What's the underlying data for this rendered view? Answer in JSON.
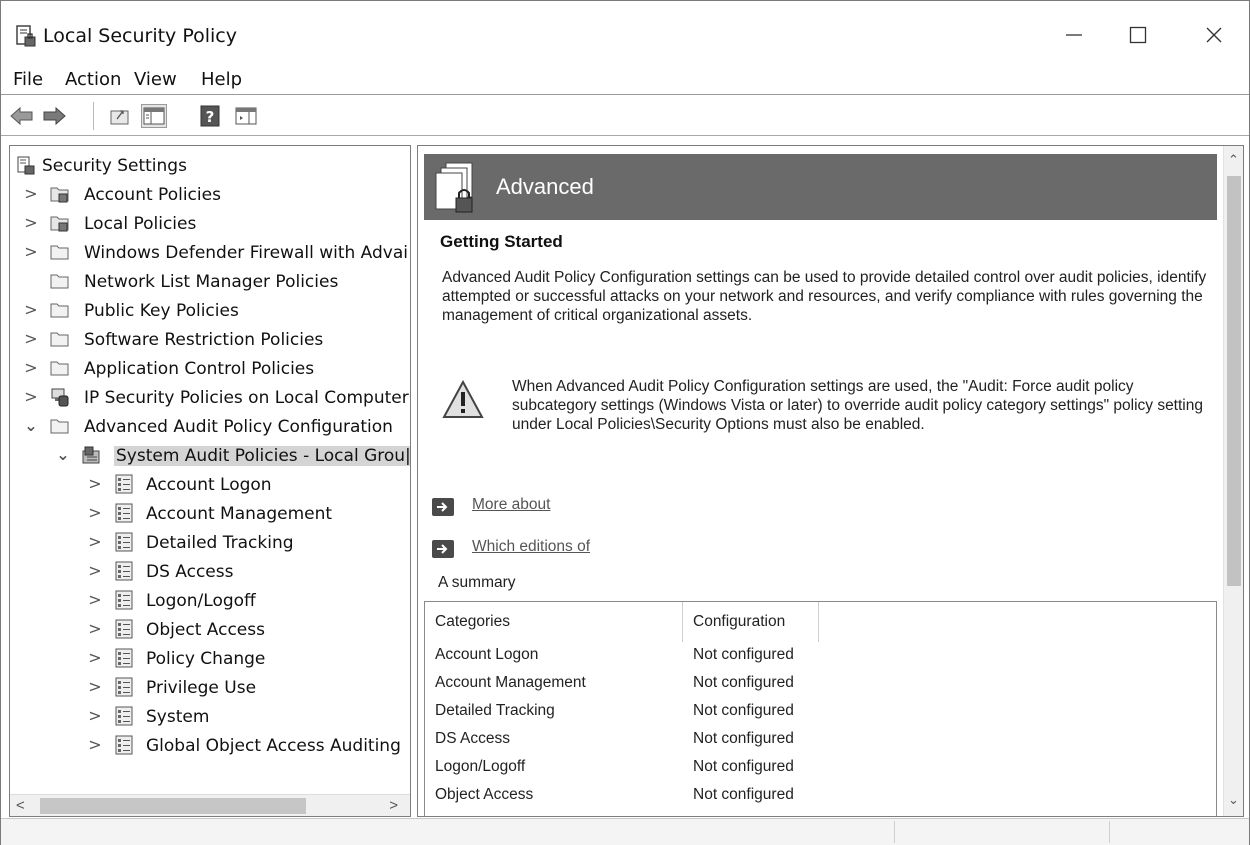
{
  "window": {
    "title": "Local Security Policy"
  },
  "menu": {
    "file": "File",
    "action": "Action",
    "view": "View",
    "help": "Help"
  },
  "toolbar": {
    "icons": [
      "back-icon",
      "forward-icon",
      "up-folder-icon",
      "show-hide-console-tree-icon",
      "help-icon",
      "show-hide-action-pane-icon"
    ]
  },
  "tree": {
    "root": "Security Settings",
    "items": [
      {
        "label": "Account Policies",
        "icon": "folder-lock-icon"
      },
      {
        "label": "Local Policies",
        "icon": "folder-lock-icon"
      },
      {
        "label": "Windows Defender Firewall with Advai",
        "icon": "folder-icon"
      },
      {
        "label": "Network List Manager Policies",
        "icon": "folder-icon"
      },
      {
        "label": "Public Key Policies",
        "icon": "folder-icon"
      },
      {
        "label": "Software Restriction Policies",
        "icon": "folder-icon"
      },
      {
        "label": "Application Control Policies",
        "icon": "folder-icon"
      },
      {
        "label": "IP Security Policies on Local Computer",
        "icon": "ip-security-icon"
      },
      {
        "label": "Advanced Audit Policy Configuration",
        "icon": "folder-icon"
      },
      {
        "label": "System Audit Policies - Local Grou|",
        "icon": "audit-policies-icon"
      },
      {
        "label": "Account Logon",
        "icon": "policy-list-icon"
      },
      {
        "label": "Account Management",
        "icon": "policy-list-icon"
      },
      {
        "label": "Detailed Tracking",
        "icon": "policy-list-icon"
      },
      {
        "label": "DS Access",
        "icon": "policy-list-icon"
      },
      {
        "label": "Logon/Logoff",
        "icon": "policy-list-icon"
      },
      {
        "label": "Object Access",
        "icon": "policy-list-icon"
      },
      {
        "label": "Policy Change",
        "icon": "policy-list-icon"
      },
      {
        "label": "Privilege Use",
        "icon": "policy-list-icon"
      },
      {
        "label": "System",
        "icon": "policy-list-icon"
      },
      {
        "label": "Global Object Access Auditing",
        "icon": "policy-list-icon"
      }
    ],
    "selected": "System Audit Policies - Local Grou|"
  },
  "content": {
    "header_title": "Advanced",
    "getting_started_title": "Getting Started",
    "getting_started_body": "Advanced Audit Policy Configuration settings can be used to provide detailed control over audit policies, identify attempted or successful attacks on your network and resources, and verify compliance with rules governing the management of critical organizational assets.",
    "warning_text": "When Advanced Audit Policy Configuration settings are used, the \"Audit: Force audit policy subcategory settings (Windows Vista or later) to override audit policy category settings\" policy setting under Local Policies\\Security Options must also be enabled.",
    "link_1": "More about",
    "link_2": "Which editions of",
    "summary_label": "A summary",
    "table": {
      "headers": [
        "Categories",
        "Configuration"
      ],
      "rows": [
        [
          "Account Logon",
          "Not configured"
        ],
        [
          "Account Management",
          "Not configured"
        ],
        [
          "Detailed Tracking",
          "Not configured"
        ],
        [
          "DS Access",
          "Not configured"
        ],
        [
          "Logon/Logoff",
          "Not configured"
        ],
        [
          "Object Access",
          "Not configured"
        ]
      ]
    }
  },
  "colors": {
    "header_band": "#6a6a6a",
    "selection": "#d4d4d4"
  }
}
